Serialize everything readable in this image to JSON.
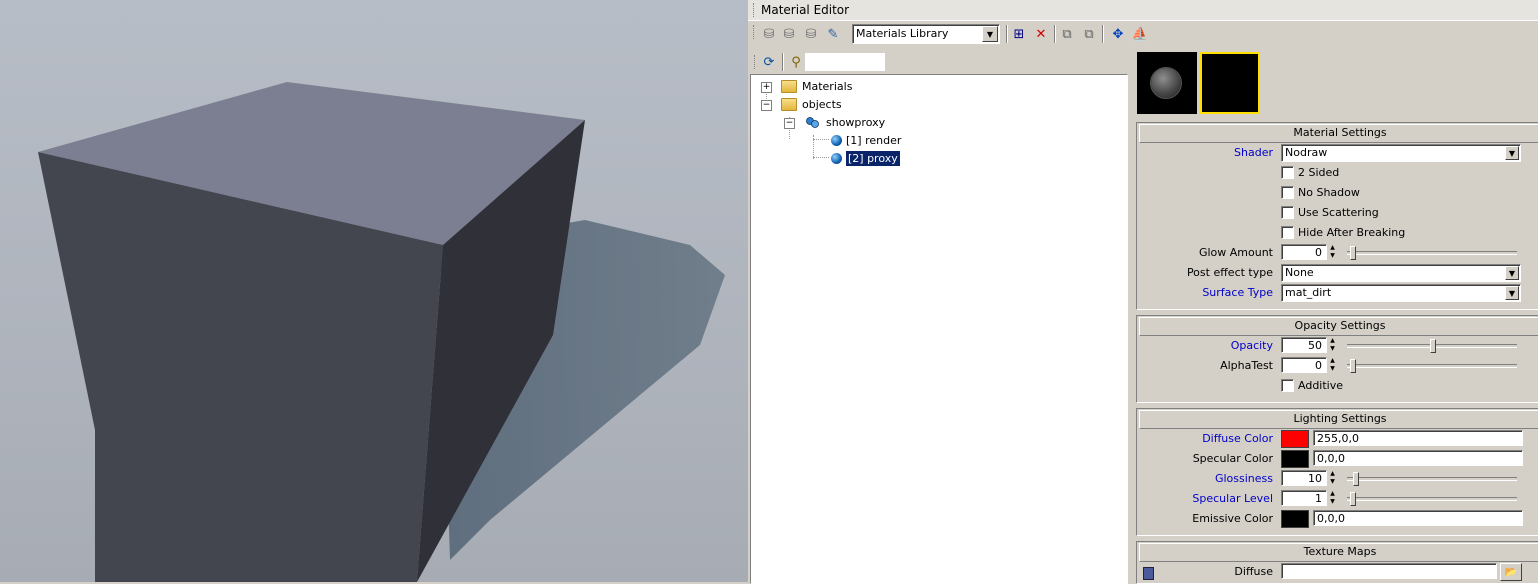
{
  "editor": {
    "title": "Material Editor",
    "library_combo": "Materials Library"
  },
  "tree": {
    "materials": "Materials",
    "objects": "objects",
    "showproxy": "showproxy",
    "render": "[1] render",
    "proxy": "[2] proxy"
  },
  "material_settings": {
    "header": "Material Settings",
    "shader_label": "Shader",
    "shader_value": "Nodraw",
    "two_sided": "2 Sided",
    "no_shadow": "No Shadow",
    "use_scattering": "Use Scattering",
    "hide_after_breaking": "Hide After Breaking",
    "glow_label": "Glow Amount",
    "glow_value": "0",
    "glow_fraction": 0,
    "post_effect_label": "Post effect type",
    "post_effect_value": "None",
    "surface_type_label": "Surface Type",
    "surface_type_value": "mat_dirt"
  },
  "opacity_settings": {
    "header": "Opacity Settings",
    "opacity_label": "Opacity",
    "opacity_value": "50",
    "opacity_fraction": 0.5,
    "alphatest_label": "AlphaTest",
    "alphatest_value": "0",
    "additive": "Additive"
  },
  "lighting_settings": {
    "header": "Lighting Settings",
    "diffuse_label": "Diffuse Color",
    "diffuse_value": "255,0,0",
    "diffuse_color": "#ff0000",
    "specular_label": "Specular Color",
    "specular_value": "0,0,0",
    "specular_color": "#000000",
    "glossiness_label": "Glossiness",
    "glossiness_value": "10",
    "specular_level_label": "Specular Level",
    "specular_level_value": "1",
    "emissive_label": "Emissive Color",
    "emissive_value": "0,0,0",
    "emissive_color": "#000000"
  },
  "texture_maps": {
    "header": "Texture Maps",
    "diffuse_label": "Diffuse",
    "diffuse_value": ""
  }
}
